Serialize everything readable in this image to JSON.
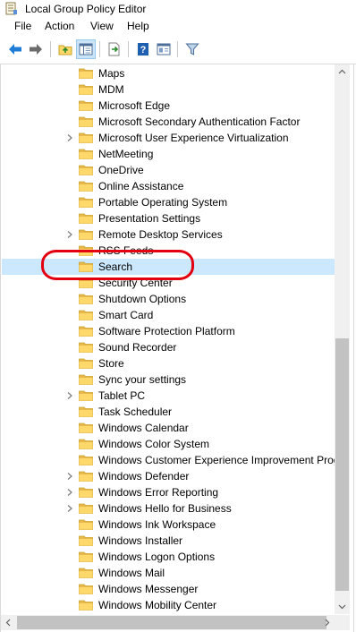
{
  "window": {
    "title": "Local Group Policy Editor"
  },
  "menu": [
    "File",
    "Action",
    "View",
    "Help"
  ],
  "toolbar": {
    "buttons": [
      "back-icon",
      "forward-icon",
      "up-folder-icon",
      "show-hide-tree-icon",
      "export-list-icon",
      "help-icon",
      "properties-pane-icon",
      "filter-icon"
    ]
  },
  "tree": {
    "items": [
      {
        "label": "Maps",
        "expandable": false
      },
      {
        "label": "MDM",
        "expandable": false
      },
      {
        "label": "Microsoft Edge",
        "expandable": false
      },
      {
        "label": "Microsoft Secondary Authentication Factor",
        "expandable": false
      },
      {
        "label": "Microsoft User Experience Virtualization",
        "expandable": true
      },
      {
        "label": "NetMeeting",
        "expandable": false
      },
      {
        "label": "OneDrive",
        "expandable": false
      },
      {
        "label": "Online Assistance",
        "expandable": false
      },
      {
        "label": "Portable Operating System",
        "expandable": false
      },
      {
        "label": "Presentation Settings",
        "expandable": false
      },
      {
        "label": "Remote Desktop Services",
        "expandable": true
      },
      {
        "label": "RSS Feeds",
        "expandable": false
      },
      {
        "label": "Search",
        "expandable": false,
        "selected": true
      },
      {
        "label": "Security Center",
        "expandable": false
      },
      {
        "label": "Shutdown Options",
        "expandable": false
      },
      {
        "label": "Smart Card",
        "expandable": false
      },
      {
        "label": "Software Protection Platform",
        "expandable": false
      },
      {
        "label": "Sound Recorder",
        "expandable": false
      },
      {
        "label": "Store",
        "expandable": false
      },
      {
        "label": "Sync your settings",
        "expandable": false
      },
      {
        "label": "Tablet PC",
        "expandable": true
      },
      {
        "label": "Task Scheduler",
        "expandable": false
      },
      {
        "label": "Windows Calendar",
        "expandable": false
      },
      {
        "label": "Windows Color System",
        "expandable": false
      },
      {
        "label": "Windows Customer Experience Improvement Prog",
        "expandable": false
      },
      {
        "label": "Windows Defender",
        "expandable": true
      },
      {
        "label": "Windows Error Reporting",
        "expandable": true
      },
      {
        "label": "Windows Hello for Business",
        "expandable": true
      },
      {
        "label": "Windows Ink Workspace",
        "expandable": false
      },
      {
        "label": "Windows Installer",
        "expandable": false
      },
      {
        "label": "Windows Logon Options",
        "expandable": false
      },
      {
        "label": "Windows Mail",
        "expandable": false
      },
      {
        "label": "Windows Messenger",
        "expandable": false
      },
      {
        "label": "Windows Mobility Center",
        "expandable": false
      }
    ]
  },
  "annotation": {
    "color": "#e3000f",
    "target": "Search"
  },
  "colors": {
    "selection": "#cce8ff",
    "folder": "#ffd86b",
    "accent_blue": "#1e7bd6"
  }
}
